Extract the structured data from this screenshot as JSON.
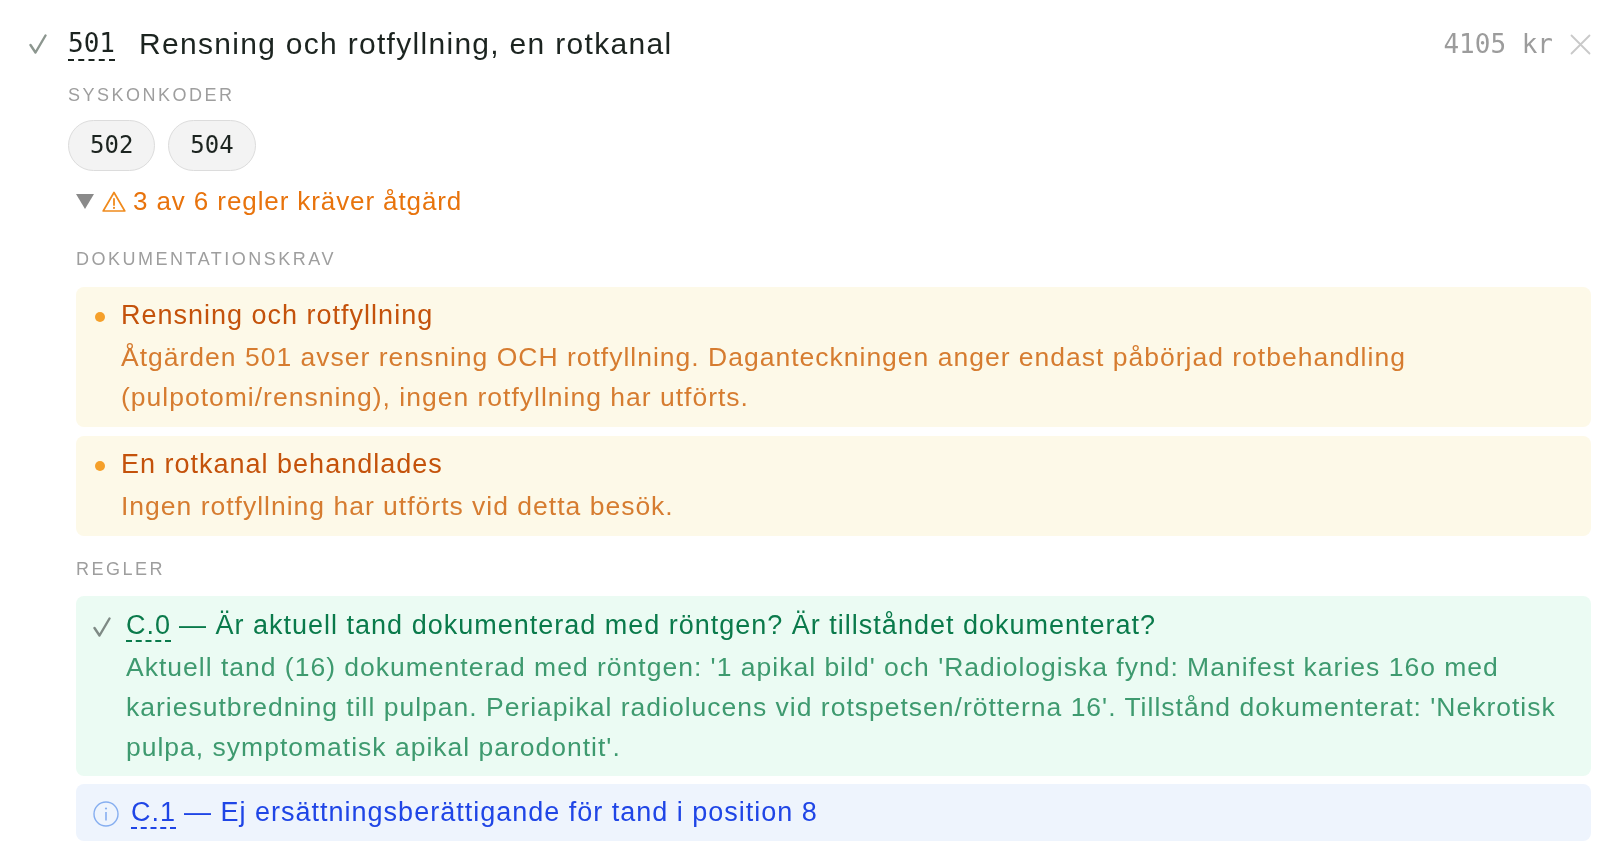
{
  "item": {
    "checked": true,
    "code": "501",
    "title": "Rensning och rotfyllning, en rotkanal",
    "price": "4105 kr"
  },
  "sibling_codes": {
    "heading": "SYSKONKODER",
    "codes": [
      "502",
      "504"
    ]
  },
  "rule_summary": {
    "label": "3 av 6 regler kräver åtgärd",
    "expanded": true
  },
  "documentation": {
    "heading": "DOKUMENTATIONSKRAV",
    "items": [
      {
        "title": "Rensning och rotfyllning",
        "text": "Åtgärden 501 avser rensning OCH rotfyllning. Daganteckningen anger endast påbörjad rotbehandling (pulpotomi/rensning), ingen rotfyllning har utförts."
      },
      {
        "title": "En rotkanal behandlades",
        "text": "Ingen rotfyllning har utförts vid detta besök."
      }
    ]
  },
  "rules": {
    "heading": "REGLER",
    "items": [
      {
        "kind": "pass",
        "code": "C.0",
        "title": "— Är aktuell tand dokumenterad med röntgen? Är tillståndet dokumenterat?",
        "text": "Aktuell tand (16) dokumenterad med röntgen: '1 apikal bild' och 'Radiologiska fynd: Manifest karies 16o med kariesutbredning till pulpan. Periapikal radiolucens vid rotspetsen/rötterna 16'. Tillstånd dokumenterat: 'Nekrotisk pulpa, symptomatisk apikal parodontit'."
      },
      {
        "kind": "info",
        "code": "C.1",
        "title": "— Ej ersättningsberättigande för tand i position 8"
      }
    ]
  }
}
